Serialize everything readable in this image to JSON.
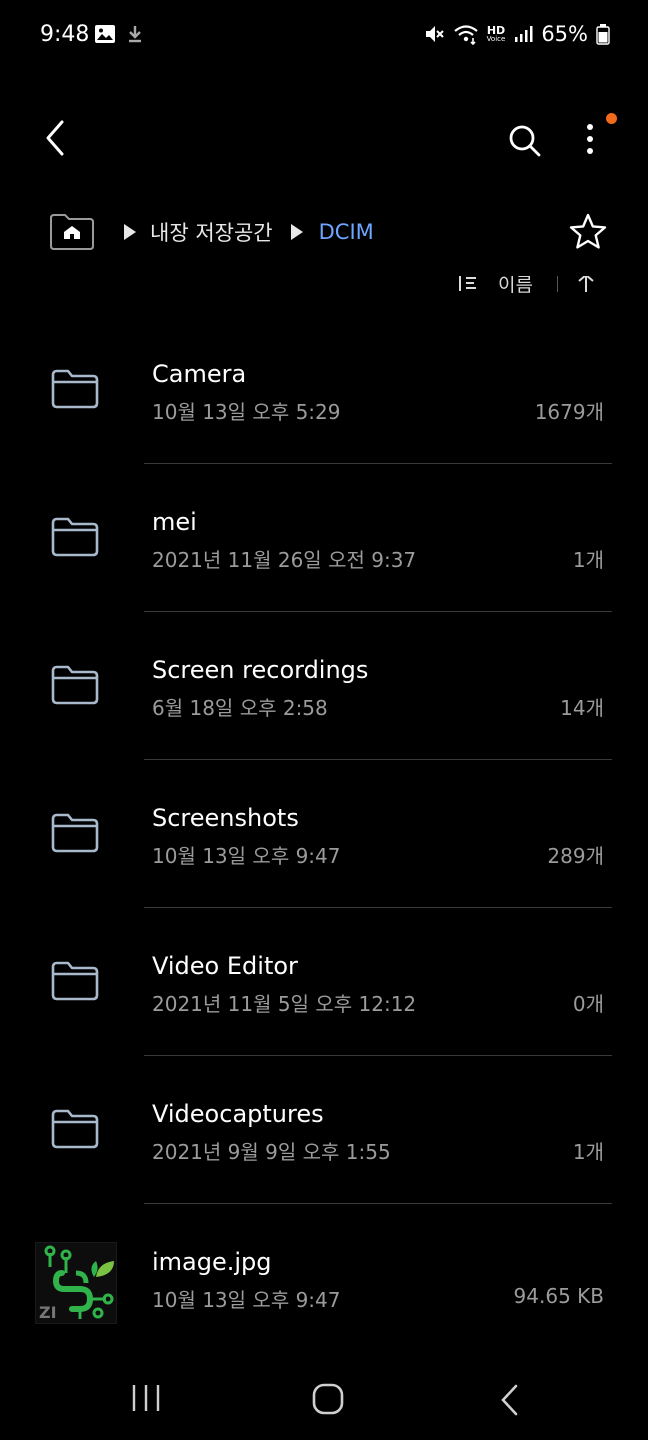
{
  "status_bar": {
    "time": "9:48",
    "battery": "65%",
    "network_badge": "HD",
    "network_badge_sub": "Voice",
    "icons": [
      "image-icon",
      "download-icon",
      "mute-icon",
      "wifi-icon",
      "signal-icon",
      "battery-icon"
    ]
  },
  "toolbar": {
    "back_icon": "chevron-left-icon",
    "search_icon": "search-icon",
    "more_icon": "more-vertical-icon",
    "notification_dot_color": "#f26a1b"
  },
  "breadcrumb": {
    "home_icon": "home-folder-icon",
    "path": [
      "내장 저장공간"
    ],
    "current": "DCIM",
    "current_color": "#6ea6ff",
    "favorite_icon": "star-icon"
  },
  "sort": {
    "label": "이름",
    "sort_icon": "sort-icon",
    "direction_icon": "sort-direction-icon"
  },
  "files": [
    {
      "name": "Camera",
      "date": "10월 13일 오후 5:29",
      "count": "1679개",
      "type": "folder"
    },
    {
      "name": "mei",
      "date": "2021년 11월 26일 오전 9:37",
      "count": "1개",
      "type": "folder"
    },
    {
      "name": "Screen recordings",
      "date": "6월 18일 오후 2:58",
      "count": "14개",
      "type": "folder"
    },
    {
      "name": "Screenshots",
      "date": "10월 13일 오후 9:47",
      "count": "289개",
      "type": "folder"
    },
    {
      "name": "Video Editor",
      "date": "2021년 11월 5일 오후 12:12",
      "count": "0개",
      "type": "folder"
    },
    {
      "name": "Videocaptures",
      "date": "2021년 9월 9일 오후 1:55",
      "count": "1개",
      "type": "folder"
    },
    {
      "name": "image.jpg",
      "date": "10월 13일 오후 9:47",
      "count": "94.65 KB",
      "type": "image"
    }
  ],
  "image_thumb_label": "ZI",
  "nav_bar": {
    "recent_icon": "recent-apps-icon",
    "home_icon": "home-icon",
    "back_icon": "back-icon"
  }
}
